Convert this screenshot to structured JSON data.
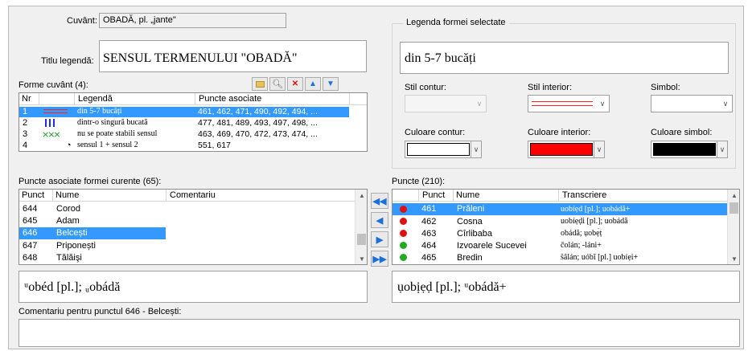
{
  "word": {
    "label": "Cuvânt:",
    "value": "OBADĂ, pl. „jante\""
  },
  "legend_title": {
    "label": "Titlu legendă:",
    "value": "SENSUL TERMENULUI \"OBADĂ\""
  },
  "word_forms": {
    "label": "Forme cuvânt (4):",
    "columns": [
      "Nr",
      "Legendă",
      "Puncte asociate"
    ],
    "rows": [
      {
        "nr": "1",
        "legend": "din 5-7 bucăți",
        "points": "461, 462, 471, 490, 492, 494, ...",
        "symbol": "double-red-line"
      },
      {
        "nr": "2",
        "legend": "dintr-o singură bucată",
        "points": "477, 481, 489, 493, 497, 498, ...",
        "symbol": "blue-vertical-lines"
      },
      {
        "nr": "3",
        "legend": "nu se poate stabili sensul",
        "points": "463, 469, 470, 472, 473, 474, ...",
        "symbol": "green-cross-hatch"
      },
      {
        "nr": "4",
        "legend": "sensul 1 + sensul 2",
        "points": "551, 617",
        "symbol": "half-circle"
      }
    ]
  },
  "selected_form": {
    "label": "Legenda formei selectate",
    "value": "din 5-7 bucăți",
    "stil_contur": "Stil contur:",
    "stil_interior": "Stil interior:",
    "simbol": "Simbol:",
    "culoare_contur": "Culoare contur:",
    "culoare_interior": "Culoare interior:",
    "culoare_simbol": "Culoare simbol:",
    "interior_color": "#ff0000",
    "symbol_color": "#000000",
    "contour_color": "#ffffff"
  },
  "associated_points": {
    "label": "Puncte asociate formei curente (65):",
    "columns": [
      "Punct",
      "Nume",
      "Comentariu"
    ],
    "rows": [
      {
        "punct": "644",
        "nume": "Corod",
        "comentariu": ""
      },
      {
        "punct": "645",
        "nume": "Adam",
        "comentariu": ""
      },
      {
        "punct": "646",
        "nume": "Belcești",
        "comentariu": ""
      },
      {
        "punct": "647",
        "nume": "Priponești",
        "comentariu": ""
      },
      {
        "punct": "648",
        "nume": "Tălăişi",
        "comentariu": ""
      }
    ],
    "selected_index": 2,
    "transcription": "ᵘobéd [pl.]; ᵤobádă"
  },
  "points": {
    "label": "Puncte (210):",
    "columns": [
      "Punct",
      "Nume",
      "Transcriere"
    ],
    "rows": [
      {
        "punct": "461",
        "nume": "Prăleni",
        "transcriere": "uobíẹd [pl.]; uobádă+",
        "dot": "#dd1111"
      },
      {
        "punct": "462",
        "nume": "Cosna",
        "transcriere": "uobíẹḍi [pl.]; uobádă",
        "dot": "#dd1111"
      },
      {
        "punct": "463",
        "nume": "Cîrlibaba",
        "transcriere": "obádă; ụobẹ́ț",
        "dot": "#dd1111"
      },
      {
        "punct": "464",
        "nume": "Izvoarele Sucevei",
        "transcriere": "čolán; -láni+",
        "dot": "#22aa22"
      },
      {
        "punct": "465",
        "nume": "Bredin",
        "transcriere": "ŝâlán; uóbĭ [pl.] uobíẹi+",
        "dot": "#22aa22"
      }
    ],
    "transcription": "ụobịẹḍ [pl.]; ᵘobádă+"
  },
  "comment": {
    "label": "Comentariu pentru punctul 646 - Belcești:",
    "value": ""
  }
}
